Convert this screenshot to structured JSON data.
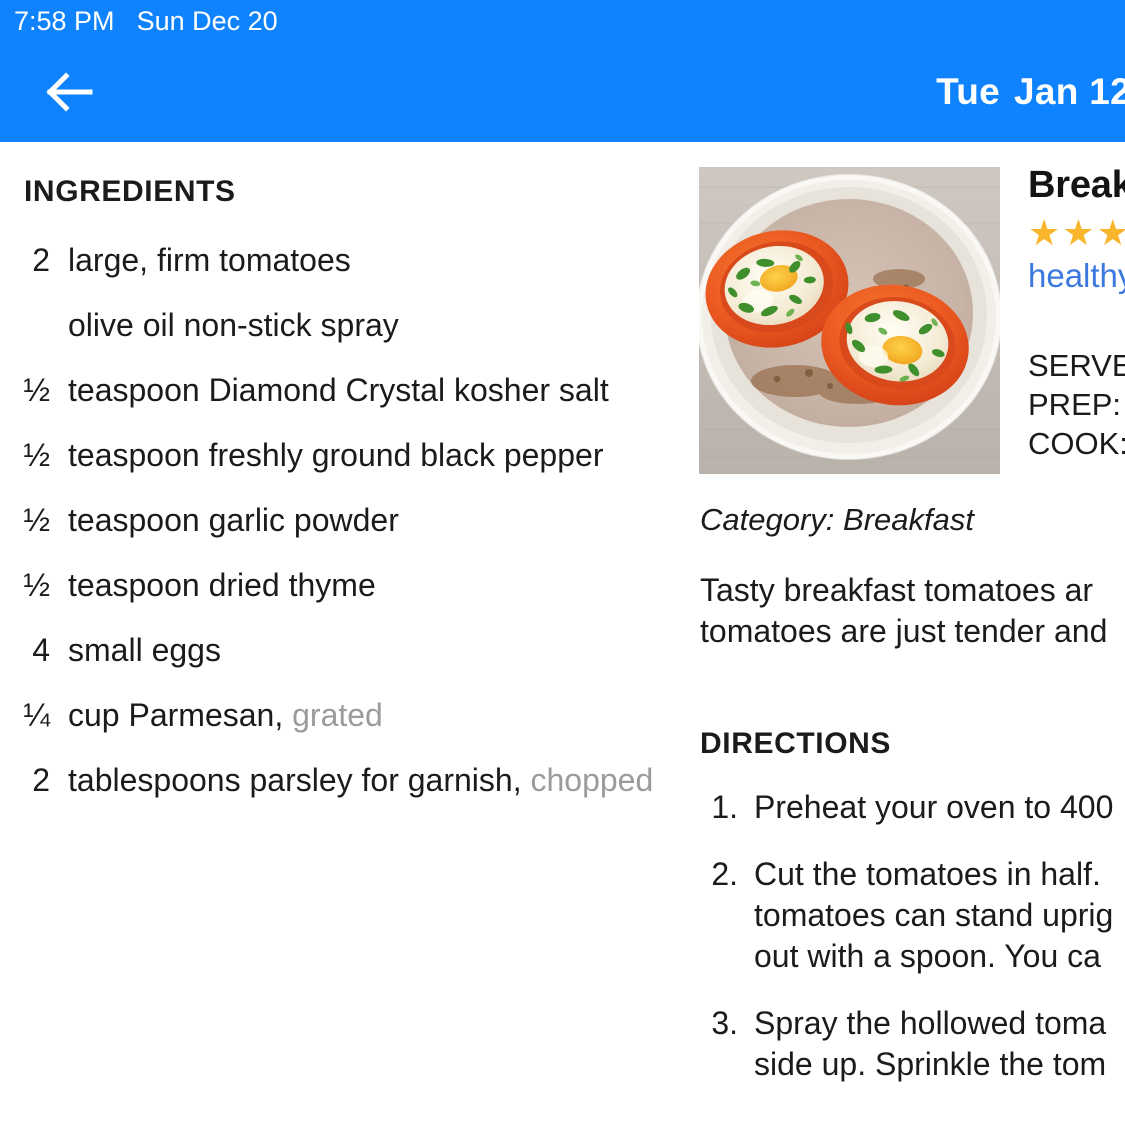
{
  "status_bar": {
    "time": "7:58 PM",
    "date": "Sun Dec 20"
  },
  "app_bar": {
    "back_icon": "back-arrow-icon",
    "title_day": "Tue",
    "title_date": "Jan 12",
    "background_color": "#0f83fd"
  },
  "ingredients_section": {
    "heading": "INGREDIENTS",
    "items": [
      {
        "qty": "2",
        "text": "large, firm tomatoes",
        "modifier": ""
      },
      {
        "qty": "",
        "text": "olive oil non-stick spray",
        "modifier": ""
      },
      {
        "qty": "½",
        "text": "teaspoon Diamond Crystal kosher salt",
        "modifier": ""
      },
      {
        "qty": "½",
        "text": "teaspoon freshly ground black pepper",
        "modifier": ""
      },
      {
        "qty": "½",
        "text": "teaspoon garlic powder",
        "modifier": ""
      },
      {
        "qty": "½",
        "text": "teaspoon dried thyme",
        "modifier": ""
      },
      {
        "qty": "4",
        "text": "small eggs",
        "modifier": ""
      },
      {
        "qty": "¼",
        "text": "cup Parmesan,",
        "modifier": "grated"
      },
      {
        "qty": "2",
        "text": "tablespoons parsley for\ngarnish,",
        "modifier": "chopped"
      }
    ]
  },
  "recipe": {
    "photo_alt": "baked-tomatoes-with-eggs-photo",
    "title": "Break",
    "rating_stars": 3,
    "star_glyph": "★",
    "star_color": "#f9b52c",
    "tags": "healthy",
    "tag_color": "#3b78e0",
    "meta": [
      "SERVES",
      "PREP:",
      "COOK:"
    ],
    "category_line": "Category: Breakfast",
    "description": "Tasty breakfast tomatoes ar\ntomatoes are just tender and"
  },
  "directions_section": {
    "heading": "DIRECTIONS",
    "steps": [
      {
        "num": "1.",
        "text": "Preheat your oven to 400"
      },
      {
        "num": "2.",
        "text": "Cut the tomatoes in half.\ntomatoes can stand uprig\nout with a spoon. You ca"
      },
      {
        "num": "3.",
        "text": "Spray the hollowed toma\nside up. Sprinkle the tom"
      }
    ]
  }
}
